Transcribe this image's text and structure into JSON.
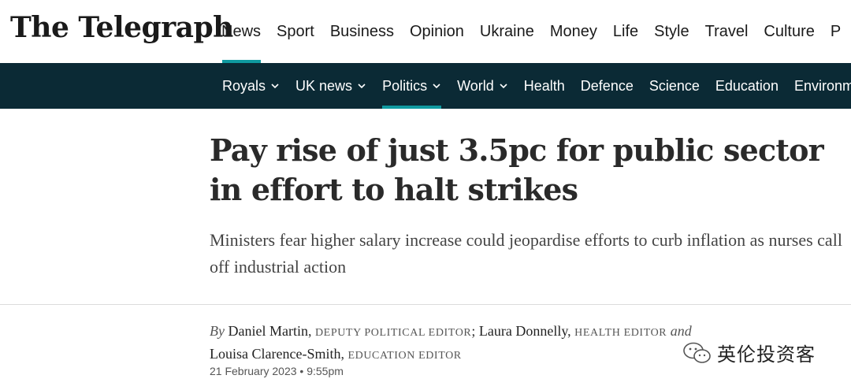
{
  "masthead": {
    "logo": "The Telegraph",
    "nav": [
      {
        "label": "News",
        "active": true
      },
      {
        "label": "Sport",
        "active": false
      },
      {
        "label": "Business",
        "active": false
      },
      {
        "label": "Opinion",
        "active": false
      },
      {
        "label": "Ukraine",
        "active": false
      },
      {
        "label": "Money",
        "active": false
      },
      {
        "label": "Life",
        "active": false
      },
      {
        "label": "Style",
        "active": false
      },
      {
        "label": "Travel",
        "active": false
      },
      {
        "label": "Culture",
        "active": false
      },
      {
        "label": "P",
        "active": false
      }
    ]
  },
  "subnav": {
    "items": [
      {
        "label": "Royals",
        "has_dropdown": true,
        "active": false
      },
      {
        "label": "UK news",
        "has_dropdown": true,
        "active": false
      },
      {
        "label": "Politics",
        "has_dropdown": true,
        "active": true
      },
      {
        "label": "World",
        "has_dropdown": true,
        "active": false
      },
      {
        "label": "Health",
        "has_dropdown": false,
        "active": false
      },
      {
        "label": "Defence",
        "has_dropdown": false,
        "active": false
      },
      {
        "label": "Science",
        "has_dropdown": false,
        "active": false
      },
      {
        "label": "Education",
        "has_dropdown": false,
        "active": false
      },
      {
        "label": "Environm",
        "has_dropdown": false,
        "active": false
      }
    ]
  },
  "article": {
    "headline": "Pay rise of just 3.5pc for public sector in effort to halt strikes",
    "standfirst": "Ministers fear higher salary increase could jeopardise efforts to curb inflation as nurses call off industrial action",
    "byline": {
      "by": "By",
      "authors": [
        {
          "name": "Daniel Martin",
          "role": "Deputy Political Editor"
        },
        {
          "name": "Laura Donnelly",
          "role": "Health Editor"
        },
        {
          "name": "Louisa Clarence-Smith",
          "role": "Education Editor"
        }
      ],
      "conjunction": "and"
    },
    "date": "21 February 2023 • 9:55pm"
  },
  "watermark": {
    "icon": "wechat-icon",
    "text": "英伦投资客"
  },
  "colors": {
    "accent": "#0f9aa0",
    "subnav_bg": "#0b2a35"
  }
}
